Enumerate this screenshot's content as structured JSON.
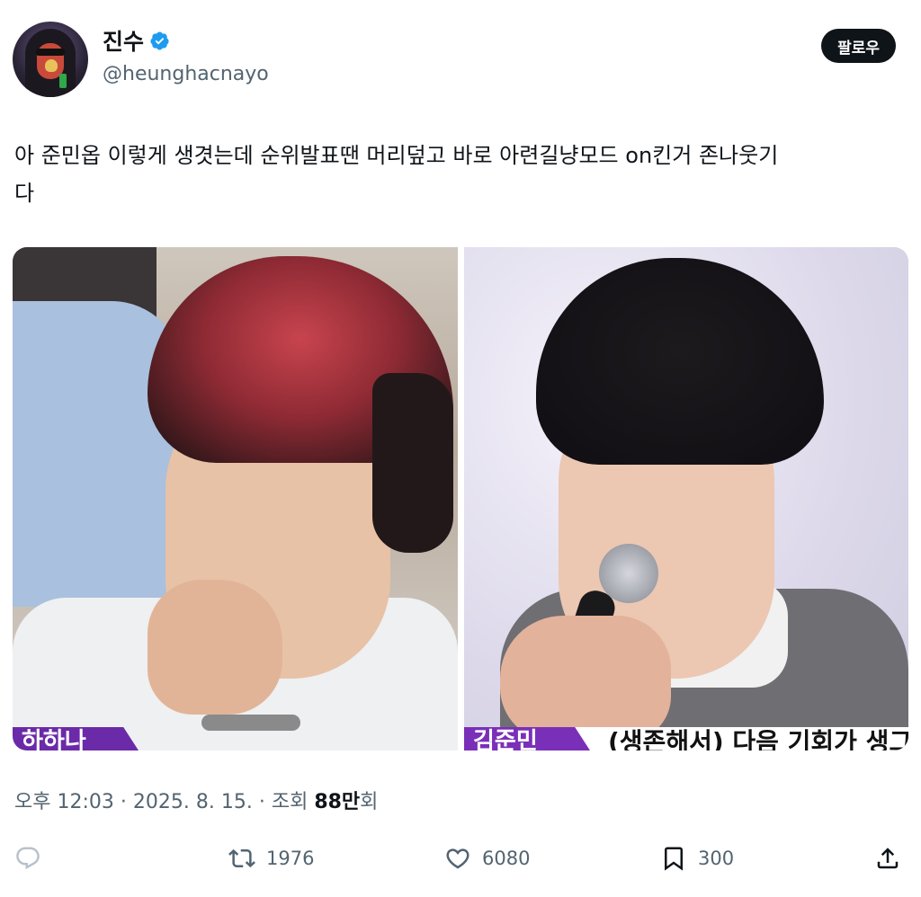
{
  "author": {
    "display_name": "진수",
    "handle": "@heunghacnayo",
    "verified": true,
    "badge_color": "#1d9bf0"
  },
  "follow_button": {
    "label": "팔로우"
  },
  "tweet": {
    "text_line1": "아 준민옵 이렇게 생겻는데 순위발표땐 머리덮고 바로 아련길냥모드 on킨거 존나웃기",
    "text_line2": "다"
  },
  "media": {
    "left_caption": "하하나",
    "right_caption_name": "김준민",
    "right_caption_text": "(생존해서) 다음 기회가 생그"
  },
  "meta": {
    "time": "오후 12:03",
    "separator": "·",
    "date": "2025. 8. 15.",
    "views_label": "조회",
    "views_count": "88만",
    "views_suffix": "회"
  },
  "actions": {
    "reply_icon": "reply-icon",
    "retweet_count": "1976",
    "like_count": "6080",
    "bookmark_count": "300",
    "share_icon": "share-icon"
  }
}
